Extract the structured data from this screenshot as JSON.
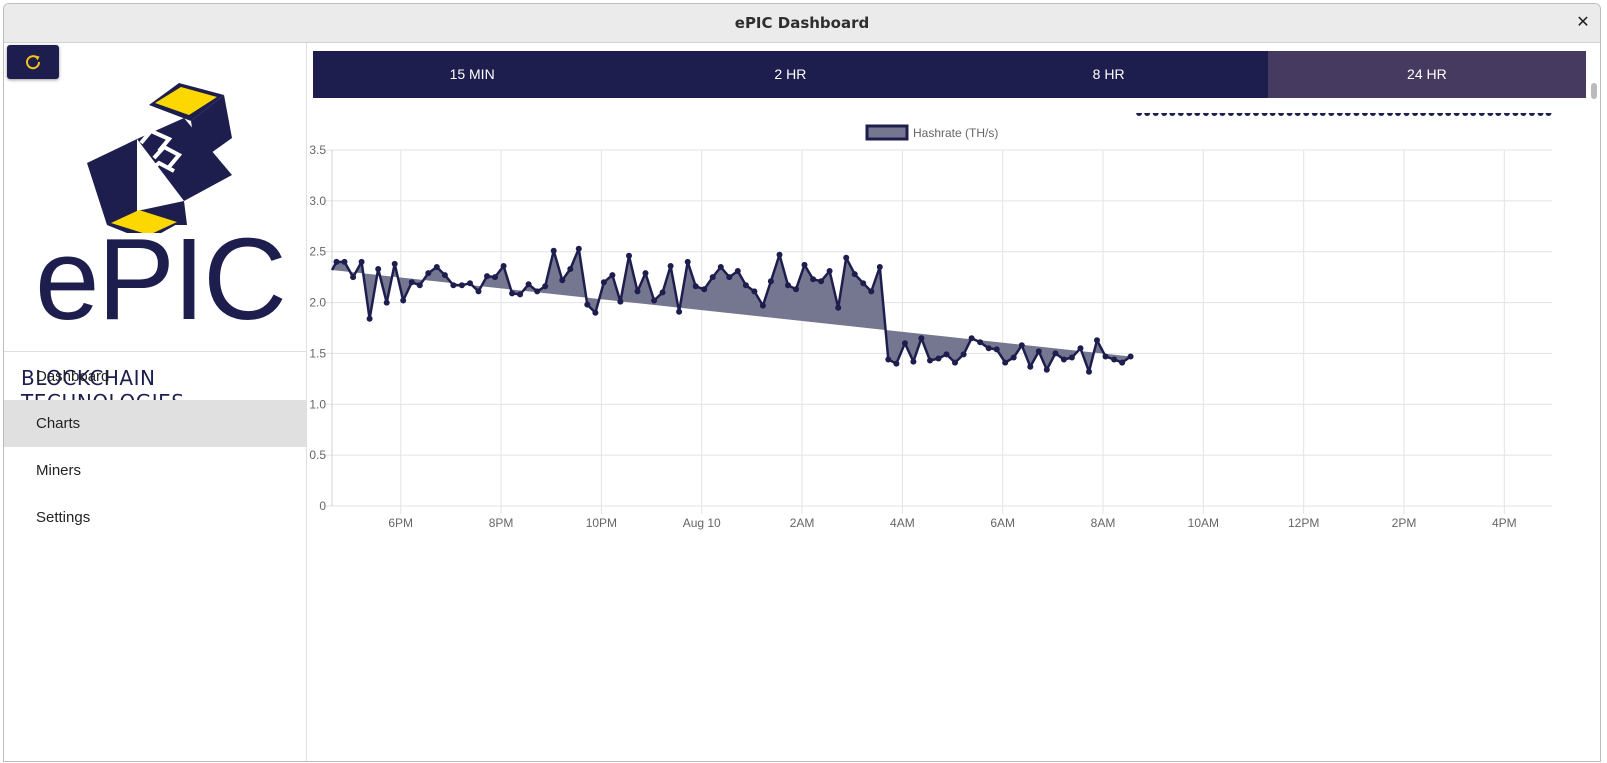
{
  "window": {
    "title": "ePIC Dashboard",
    "close_glyph": "✕"
  },
  "toolbar": {
    "refresh_icon": "refresh-icon",
    "accent": "#f5c518"
  },
  "logo": {
    "word": "ePIC",
    "tagline": "BLOCKCHAIN TECHNOLOGIES",
    "brand_color": "#1d1e4e",
    "cube_accent": "#fcd800"
  },
  "nav": {
    "items": [
      {
        "label": "Dashboard",
        "active": false
      },
      {
        "label": "Charts",
        "active": true
      },
      {
        "label": "Miners",
        "active": false
      },
      {
        "label": "Settings",
        "active": false
      }
    ]
  },
  "tabs": [
    {
      "label": "15 MIN",
      "selected": false
    },
    {
      "label": "2 HR",
      "selected": false
    },
    {
      "label": "8 HR",
      "selected": false
    },
    {
      "label": "24 HR",
      "selected": true
    }
  ],
  "chart_data": {
    "type": "area",
    "legend": [
      "Hashrate (TH/s)"
    ],
    "legend_position": "top-center",
    "grid": true,
    "ylim": [
      0,
      3.5
    ],
    "y_ticks": [
      "0",
      "0.5",
      "1.0",
      "1.5",
      "2.0",
      "2.5",
      "3.0",
      "3.5"
    ],
    "x_tick_labels": [
      "6PM",
      "8PM",
      "10PM",
      "Aug 10",
      "2AM",
      "4AM",
      "6AM",
      "8AM",
      "10AM",
      "12PM",
      "2PM",
      "4PM"
    ],
    "x_ticks_hours": [
      18,
      20,
      22,
      24,
      26,
      28,
      30,
      32,
      34,
      36,
      38,
      40
    ],
    "xlim_hours": [
      16.63,
      40.95
    ],
    "line_color": "#1d1e4e",
    "fill_color": "#75768f",
    "series": [
      {
        "name": "Hashrate (TH/s)",
        "x_hours": [
          16.72,
          16.88,
          17.05,
          17.22,
          17.38,
          17.55,
          17.72,
          17.88,
          18.05,
          18.22,
          18.38,
          18.55,
          18.72,
          18.88,
          19.05,
          19.22,
          19.38,
          19.55,
          19.72,
          19.88,
          20.05,
          20.22,
          20.38,
          20.55,
          20.72,
          20.88,
          21.05,
          21.22,
          21.38,
          21.55,
          21.72,
          21.88,
          22.05,
          22.22,
          22.38,
          22.55,
          22.72,
          22.88,
          23.05,
          23.22,
          23.38,
          23.55,
          23.72,
          23.88,
          24.05,
          24.22,
          24.38,
          24.55,
          24.72,
          24.88,
          25.05,
          25.22,
          25.38,
          25.55,
          25.72,
          25.88,
          26.05,
          26.22,
          26.38,
          26.55,
          26.72,
          26.88,
          27.05,
          27.22,
          27.38,
          27.55,
          27.72,
          27.88,
          28.05,
          28.22,
          28.38,
          28.55,
          28.72,
          28.88,
          29.05,
          29.22,
          29.38,
          29.55,
          29.72,
          29.88,
          30.05,
          30.22,
          30.38,
          30.55,
          30.72,
          30.88,
          31.05,
          31.22,
          31.38,
          31.55,
          31.72,
          31.88,
          32.05,
          32.22,
          32.38,
          32.55,
          32.72,
          32.88,
          33.05,
          33.22,
          33.38,
          33.55,
          33.72,
          33.88,
          34.05,
          34.22,
          34.38,
          34.55,
          34.72,
          34.88,
          35.05,
          35.22,
          35.38,
          35.55,
          35.72,
          35.88,
          36.05,
          36.22,
          36.38,
          36.55,
          36.72,
          36.88,
          37.05,
          37.22,
          37.38,
          37.55,
          37.72,
          37.88,
          38.05,
          38.22,
          38.38,
          38.55,
          38.72,
          38.88,
          39.05,
          39.22,
          39.38,
          39.55,
          39.72,
          39.88,
          40.05,
          40.22,
          40.38,
          40.55,
          40.72,
          40.88
        ],
        "values": [
          2.4,
          2.4,
          2.25,
          2.4,
          1.84,
          2.33,
          2.0,
          2.38,
          2.02,
          2.2,
          2.17,
          2.29,
          2.35,
          2.27,
          2.17,
          2.17,
          2.19,
          2.11,
          2.26,
          2.25,
          2.36,
          2.09,
          2.08,
          2.18,
          2.11,
          2.16,
          2.51,
          2.22,
          2.33,
          2.53,
          1.98,
          1.9,
          2.2,
          2.27,
          2.01,
          2.46,
          2.11,
          2.29,
          2.02,
          2.1,
          2.36,
          1.91,
          2.4,
          2.16,
          2.13,
          2.25,
          2.35,
          2.25,
          2.31,
          2.17,
          2.11,
          1.97,
          2.21,
          2.47,
          2.17,
          2.13,
          2.37,
          2.23,
          2.21,
          2.31,
          1.95,
          2.44,
          2.28,
          2.19,
          2.11,
          2.35,
          1.44,
          1.4,
          1.6,
          1.42,
          1.65,
          1.43,
          1.45,
          1.49,
          1.41,
          1.49,
          1.65,
          1.61,
          1.55,
          1.54,
          1.41,
          1.46,
          1.58,
          1.37,
          1.52,
          1.34,
          1.5,
          1.44,
          1.46,
          1.55,
          1.32,
          1.63,
          1.47,
          1.44,
          1.41,
          1.47
        ]
      }
    ]
  }
}
